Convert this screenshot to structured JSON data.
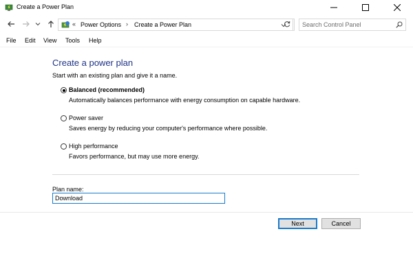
{
  "window": {
    "title": "Create a Power Plan"
  },
  "address_bar": {
    "overflow": "«",
    "breadcrumbs": [
      "Power Options",
      "Create a Power Plan"
    ],
    "separator": "›"
  },
  "search": {
    "placeholder": "Search Control Panel"
  },
  "menu": {
    "items": [
      "File",
      "Edit",
      "View",
      "Tools",
      "Help"
    ]
  },
  "main": {
    "heading": "Create a power plan",
    "subtitle": "Start with an existing plan and give it a name.",
    "options": [
      {
        "label": "Balanced (recommended)",
        "description": "Automatically balances performance with energy consumption on capable hardware.",
        "selected": true
      },
      {
        "label": "Power saver",
        "description": "Saves energy by reducing your computer's performance where possible.",
        "selected": false
      },
      {
        "label": "High performance",
        "description": "Favors performance, but may use more energy.",
        "selected": false
      }
    ],
    "plan_name_label": "Plan name:",
    "plan_name_value": "Download"
  },
  "buttons": {
    "next": "Next",
    "cancel": "Cancel"
  },
  "colors": {
    "heading": "#1e3287",
    "focus_border": "#1979ca"
  }
}
